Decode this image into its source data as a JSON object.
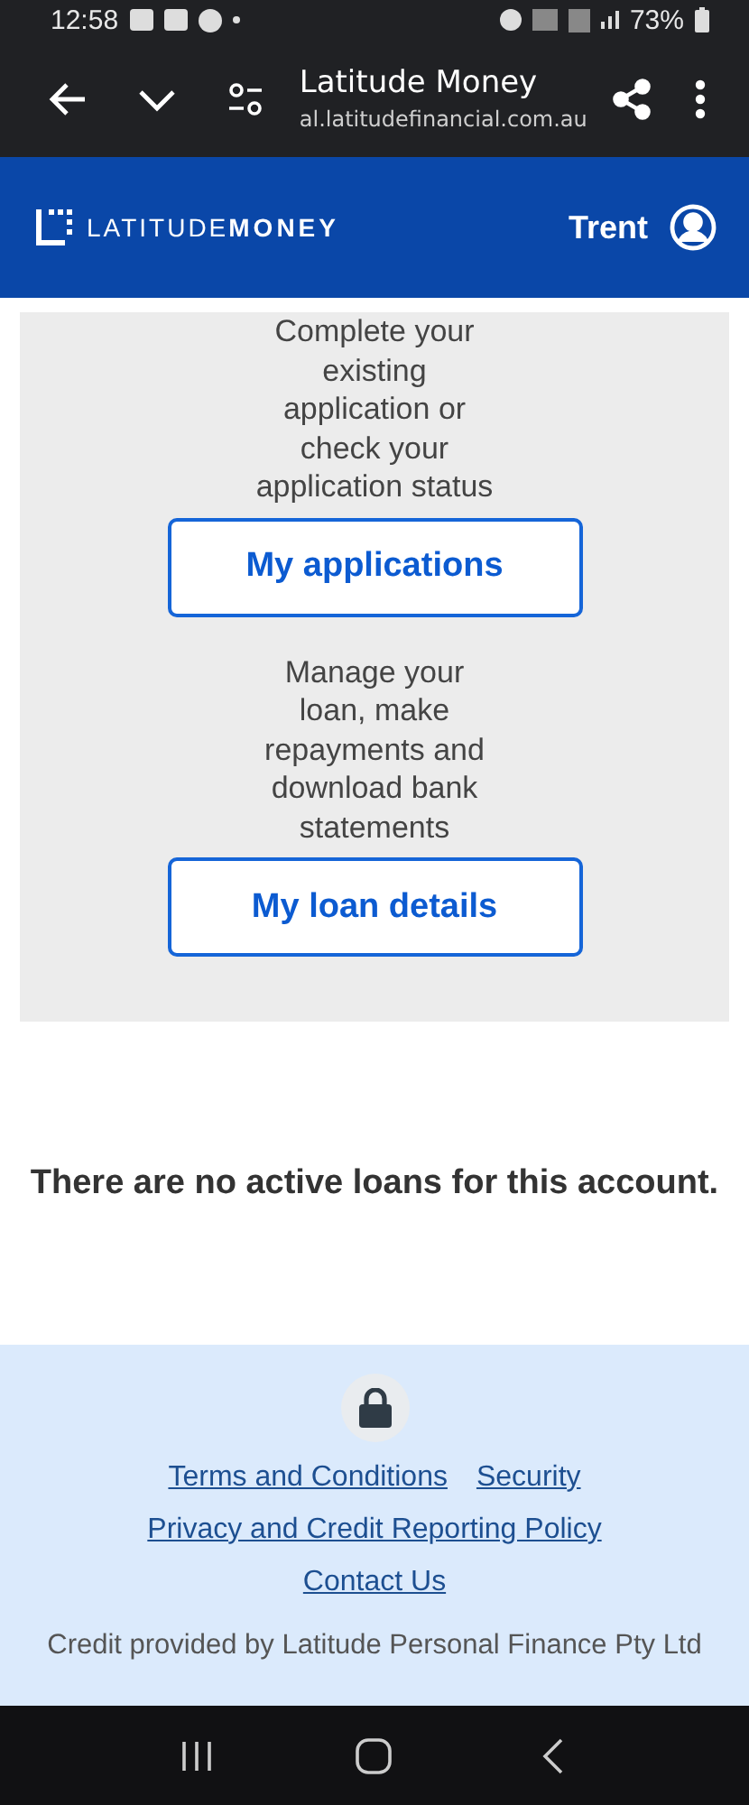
{
  "status_bar": {
    "time": "12:58",
    "battery": "73%"
  },
  "browser": {
    "title": "Latitude Money",
    "url": "al.latitudefinancial.com.au"
  },
  "header": {
    "logo_light": "LATITUDE",
    "logo_bold": "MONEY",
    "user": "Trent"
  },
  "cards": [
    {
      "description": "Complete your existing application or check your application status",
      "button": "My applications"
    },
    {
      "description": "Manage your loan, make repayments and download bank statements",
      "button": "My loan details"
    }
  ],
  "message": "There are no active loans for this account.",
  "footer": {
    "link_rows": [
      [
        "Terms and Conditions",
        "Security"
      ],
      [
        "Privacy and Credit Reporting Policy"
      ],
      [
        "Contact Us"
      ]
    ],
    "credit": "Credit provided by Latitude Personal Finance Pty Ltd"
  }
}
